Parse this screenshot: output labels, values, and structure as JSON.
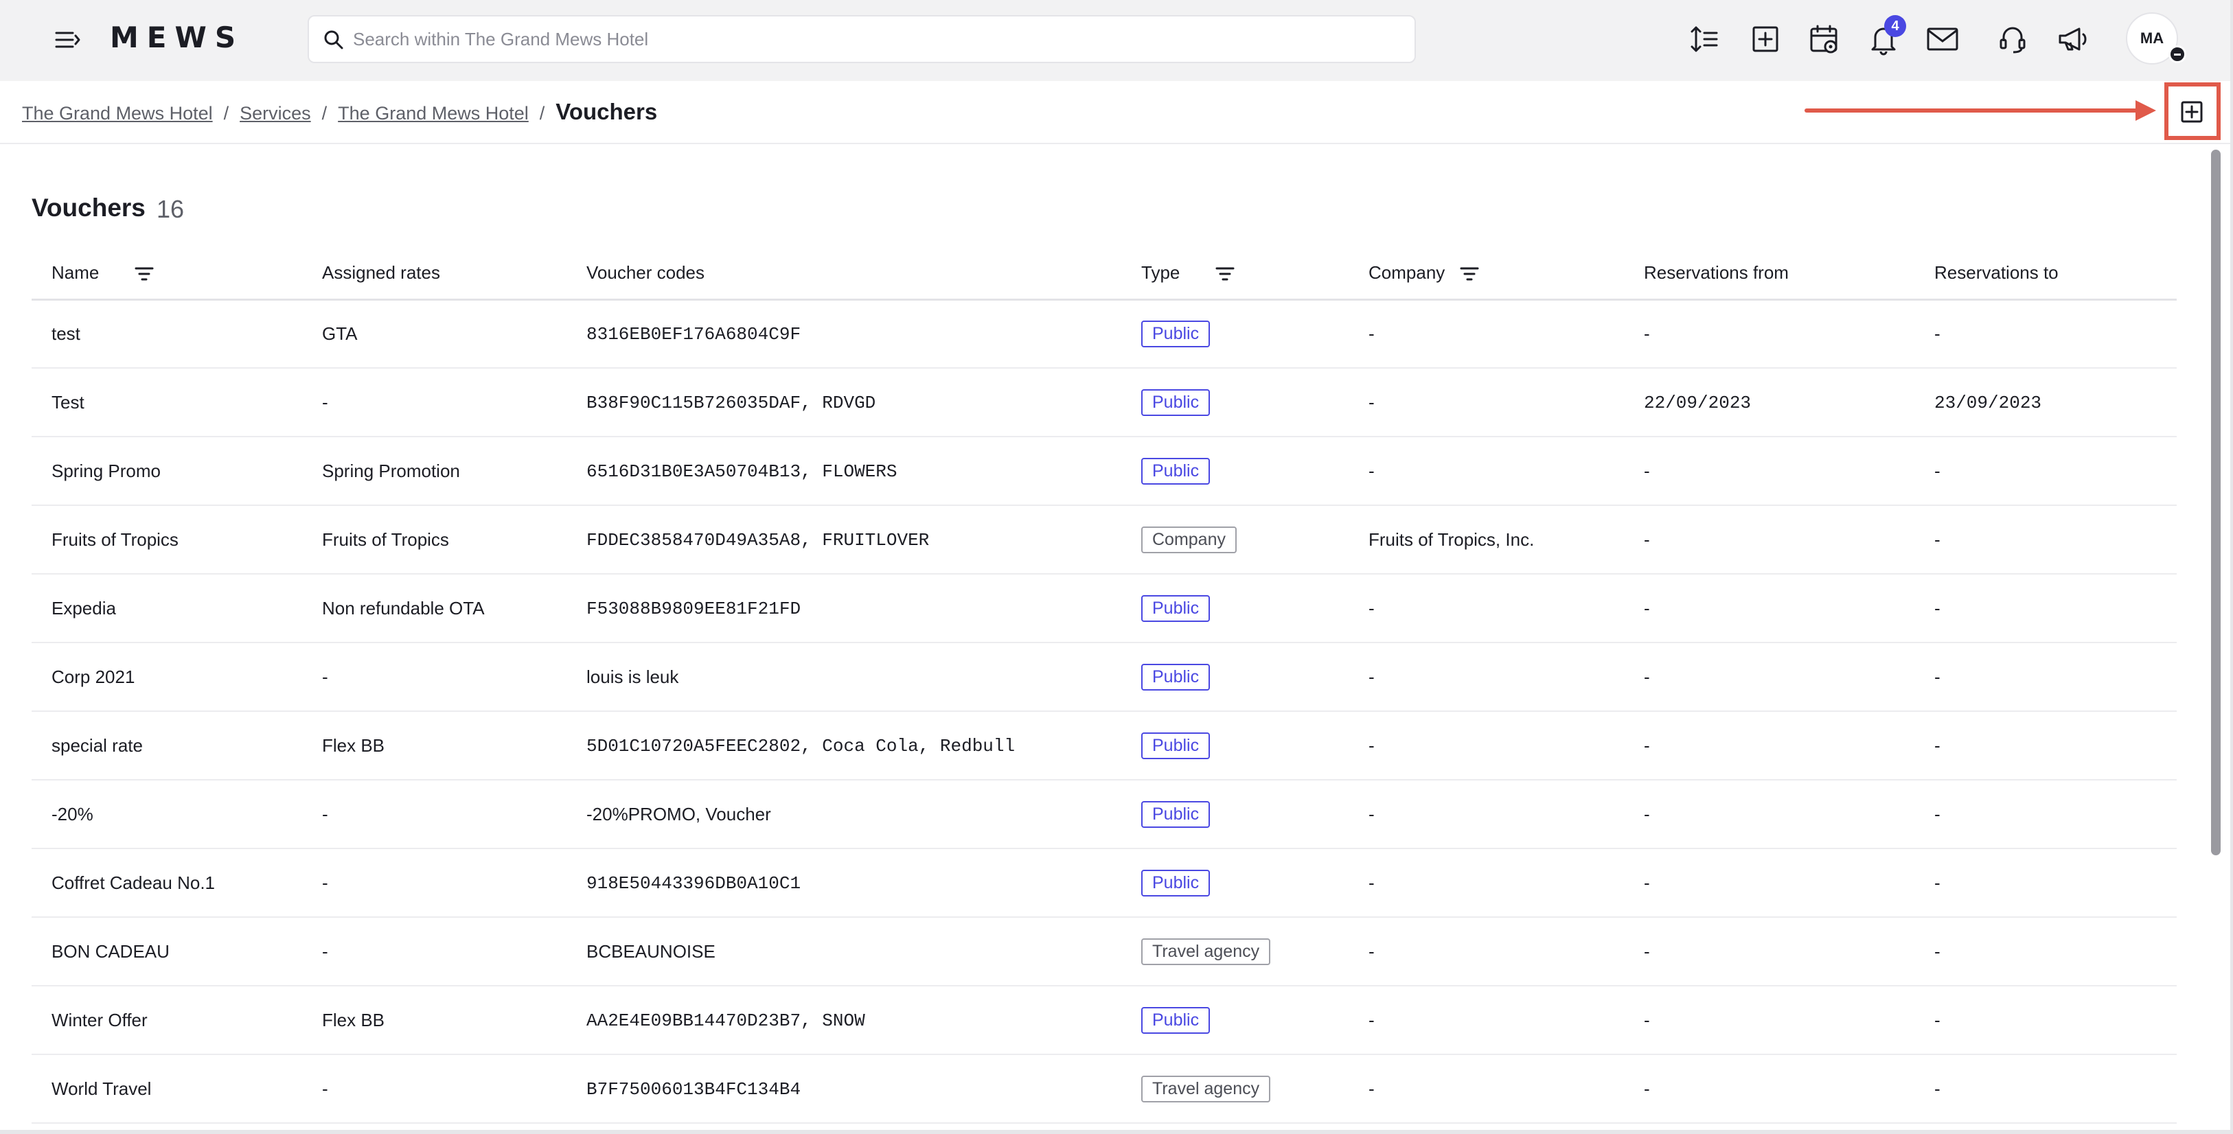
{
  "app": {
    "logo": "MEWS",
    "search_placeholder": "Search within The Grand Mews Hotel",
    "notification_count": "4",
    "user_initials": "MA",
    "accent_color": "#4a48e2",
    "highlight_color": "#e05a4a"
  },
  "topbar_icons": [
    "menu-icon",
    "sort-icon",
    "add-reservation-icon",
    "calendar-icon",
    "bell-icon",
    "mail-icon",
    "support-icon",
    "megaphone-icon"
  ],
  "breadcrumb": {
    "items": [
      "The Grand Mews Hotel",
      "Services",
      "The Grand Mews Hotel"
    ],
    "separator": "/",
    "current": "Vouchers"
  },
  "page": {
    "title": "Vouchers",
    "count": "16"
  },
  "table": {
    "columns": [
      "Name",
      "Assigned rates",
      "Voucher codes",
      "Type",
      "Company",
      "Reservations from",
      "Reservations to"
    ],
    "rows": [
      {
        "name": "test",
        "rates": "GTA",
        "codes": "8316EB0EF176A6804C9F",
        "type": "Public",
        "company": "-",
        "from": "-",
        "to": "-"
      },
      {
        "name": "Test",
        "rates": "-",
        "codes": "B38F90C115B726035DAF, RDVGD",
        "type": "Public",
        "company": "-",
        "from": "22/09/2023",
        "to": "23/09/2023"
      },
      {
        "name": "Spring Promo",
        "rates": "Spring Promotion",
        "codes": "6516D31B0E3A50704B13, FLOWERS",
        "type": "Public",
        "company": "-",
        "from": "-",
        "to": "-"
      },
      {
        "name": "Fruits of Tropics",
        "rates": "Fruits of Tropics",
        "codes": "FDDEC3858470D49A35A8, FRUITLOVER",
        "type": "Company",
        "company": "Fruits of Tropics, Inc.",
        "from": "-",
        "to": "-"
      },
      {
        "name": "Expedia",
        "rates": "Non refundable OTA",
        "codes": "F53088B9809EE81F21FD",
        "type": "Public",
        "company": "-",
        "from": "-",
        "to": "-"
      },
      {
        "name": "Corp 2021",
        "rates": "-",
        "codes": "louis is leuk",
        "type": "Public",
        "company": "-",
        "from": "-",
        "to": "-"
      },
      {
        "name": "special rate",
        "rates": "Flex BB",
        "codes": "5D01C10720A5FEEC2802, Coca Cola, Redbull",
        "type": "Public",
        "company": "-",
        "from": "-",
        "to": "-"
      },
      {
        "name": "-20%",
        "rates": "-",
        "codes": "-20%PROMO, Voucher",
        "type": "Public",
        "company": "-",
        "from": "-",
        "to": "-"
      },
      {
        "name": "Coffret Cadeau No.1",
        "rates": "-",
        "codes": "918E50443396DB0A10C1",
        "type": "Public",
        "company": "-",
        "from": "-",
        "to": "-"
      },
      {
        "name": "BON CADEAU",
        "rates": "-",
        "codes": "BCBEAUNOISE",
        "type": "Travel agency",
        "company": "-",
        "from": "-",
        "to": "-"
      },
      {
        "name": "Winter Offer",
        "rates": "Flex BB",
        "codes": "AA2E4E09BB14470D23B7, SNOW",
        "type": "Public",
        "company": "-",
        "from": "-",
        "to": "-"
      },
      {
        "name": "World Travel",
        "rates": "-",
        "codes": "B7F75006013B4FC134B4",
        "type": "Travel agency",
        "company": "-",
        "from": "-",
        "to": "-"
      }
    ]
  }
}
